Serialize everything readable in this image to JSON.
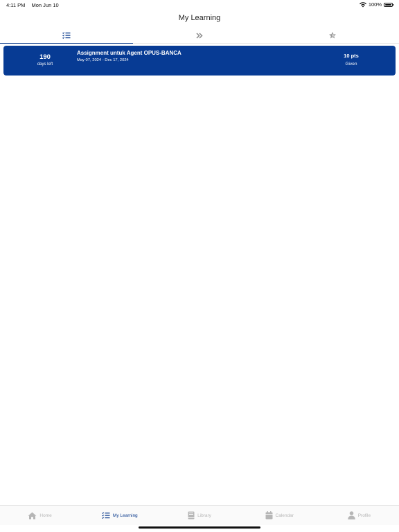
{
  "status_bar": {
    "time": "4:11 PM",
    "date": "Mon Jun 10",
    "battery": "100%"
  },
  "header": {
    "title": "My Learning"
  },
  "top_tabs": [
    {
      "icon": "list-check-icon",
      "active": true
    },
    {
      "icon": "double-chevron-right-icon",
      "active": false
    },
    {
      "icon": "star-icon",
      "active": false
    }
  ],
  "assignments": [
    {
      "days": "190",
      "days_label": "days left",
      "title": "Assignment untuk Agent OPUS-BANCA",
      "dates": "May 07, 2024 - Dec 17, 2024",
      "points": "10 pts",
      "status": "Given"
    }
  ],
  "bottom_tabs": [
    {
      "label": "Home",
      "icon": "home-icon",
      "active": false
    },
    {
      "label": "My Learning",
      "icon": "list-check-icon",
      "active": true
    },
    {
      "label": "Library",
      "icon": "book-icon",
      "active": false
    },
    {
      "label": "Calendar",
      "icon": "calendar-icon",
      "active": false
    },
    {
      "label": "Profile",
      "icon": "person-icon",
      "active": false
    }
  ],
  "colors": {
    "primary": "#073b94",
    "active_tab": "#0a3a8c",
    "inactive": "#b6b6b6"
  }
}
